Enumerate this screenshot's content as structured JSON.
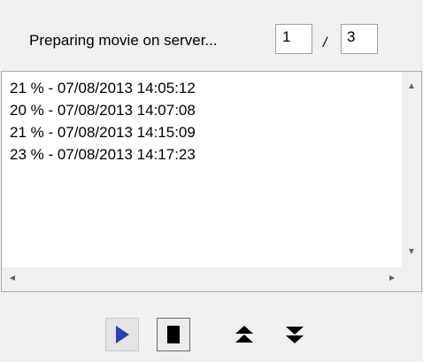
{
  "status": {
    "label": "Preparing movie on server...",
    "current": "1",
    "separator": "/",
    "total": "3"
  },
  "log": {
    "entries": [
      "21 % - 07/08/2013 14:05:12",
      "20 % - 07/08/2013 14:07:08",
      "21 % - 07/08/2013 14:15:09",
      "23 % - 07/08/2013 14:17:23"
    ]
  },
  "scrollbars": {
    "up_arrow": "▲",
    "down_arrow": "▼",
    "left_arrow": "◄",
    "right_arrow": "►"
  },
  "controls": {
    "icons": [
      "play-icon",
      "stop-icon",
      "move-up-icon",
      "move-down-icon"
    ],
    "play_color": "#2b3fb3",
    "icon_color": "#000000"
  }
}
